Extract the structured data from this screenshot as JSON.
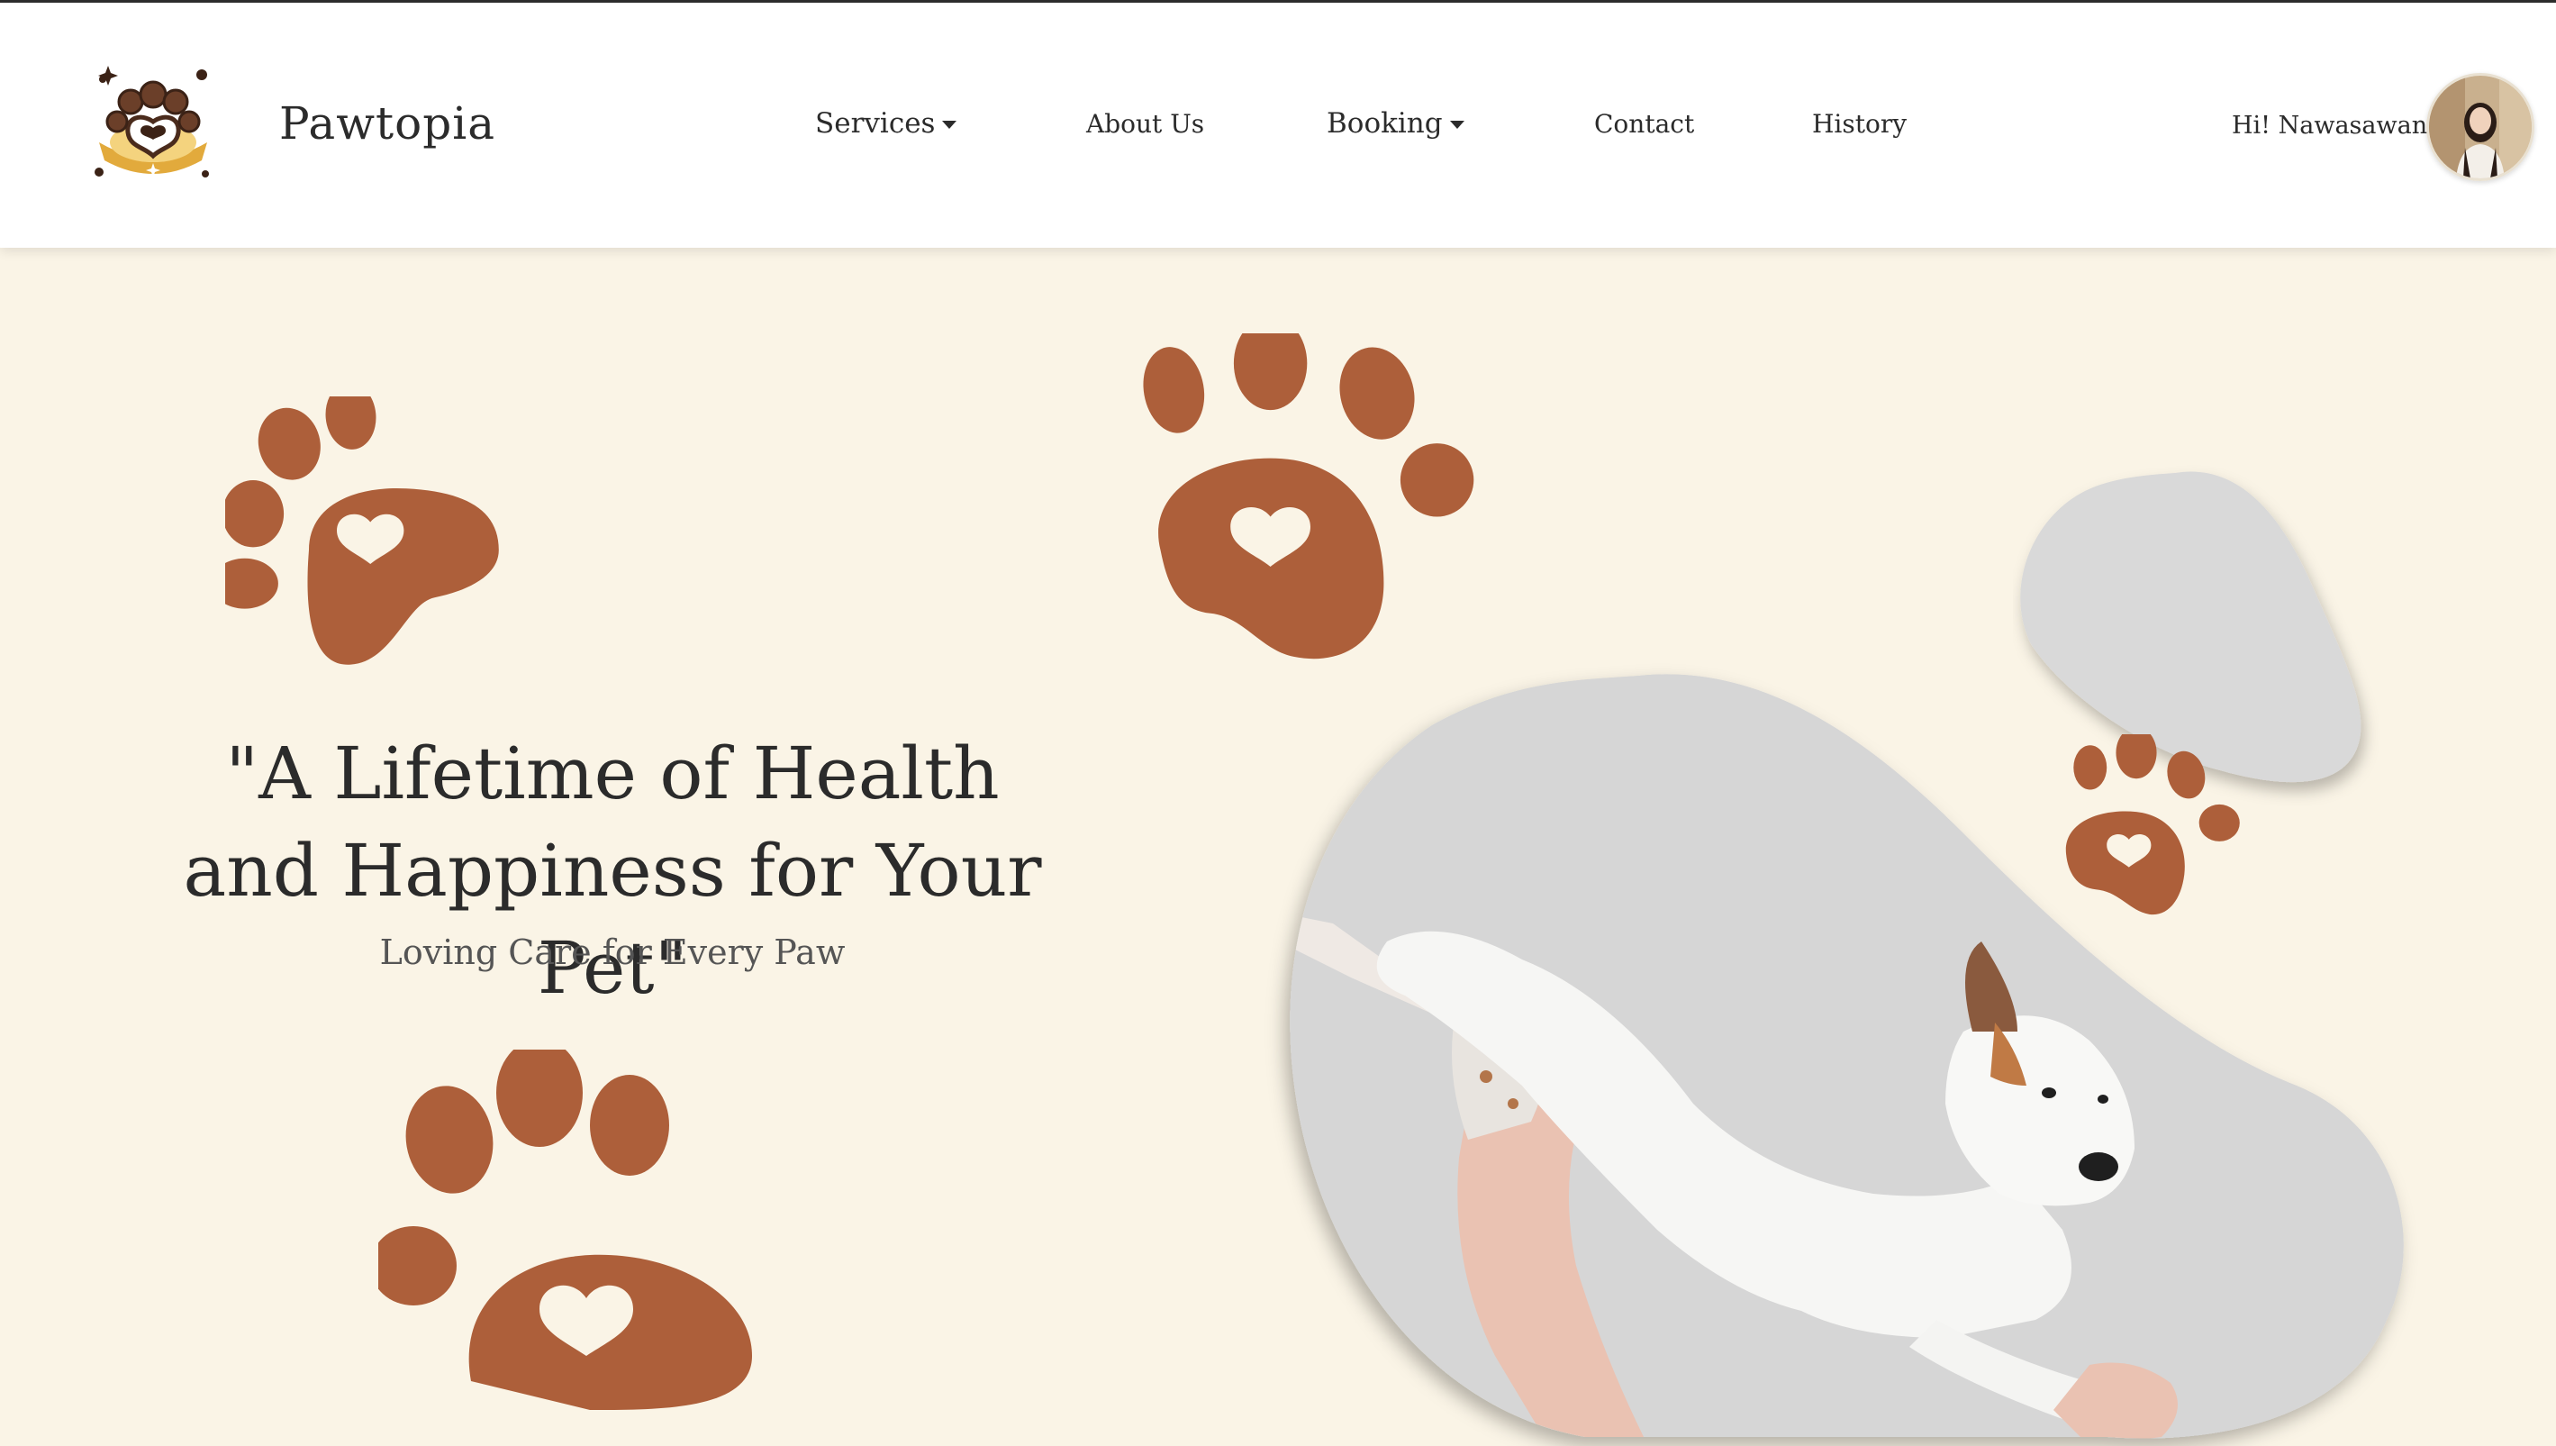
{
  "brand": {
    "name": "Pawtopia"
  },
  "nav": {
    "services": "Services",
    "about": "About Us",
    "booking": "Booking",
    "contact": "Contact",
    "history": "History"
  },
  "user": {
    "greeting": "Hi! Nawasawan"
  },
  "hero": {
    "headline_line1": "\"A Lifetime of Health",
    "headline_line2": "and Happiness for Your Pet\"",
    "tagline": "Loving Care for Every Paw"
  },
  "colors": {
    "background": "#faf4e6",
    "paw": "#ad5f3a",
    "navbar": "#ffffff",
    "blob": "#d9d9d9",
    "text": "#2b2b2b"
  },
  "icons": [
    "paw-logo-icon",
    "caret-down-icon",
    "paw-print-icon"
  ]
}
